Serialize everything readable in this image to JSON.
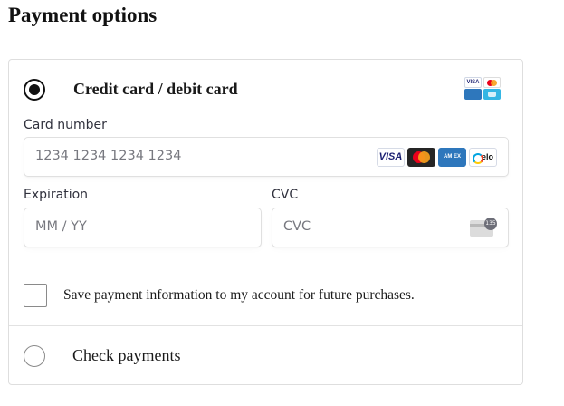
{
  "page": {
    "title": "Payment options"
  },
  "payment_methods": [
    {
      "label": "Credit card / debit card",
      "selected": true,
      "icons": [
        "visa-mini-icon",
        "mastercard-mini-icon",
        "amex-mini-icon",
        "elo-mini-icon"
      ]
    },
    {
      "label": "Check payments",
      "selected": false
    }
  ],
  "card_form": {
    "card_number": {
      "label": "Card number",
      "placeholder": "1234 1234 1234 1234",
      "value": "",
      "brands": [
        {
          "name": "visa-icon",
          "text": "VISA"
        },
        {
          "name": "mastercard-icon",
          "text": ""
        },
        {
          "name": "amex-icon",
          "text": "AM EX"
        },
        {
          "name": "elo-icon",
          "text": "elo"
        }
      ]
    },
    "expiration": {
      "label": "Expiration",
      "placeholder": "MM / YY",
      "value": ""
    },
    "cvc": {
      "label": "CVC",
      "placeholder": "CVC",
      "value": "",
      "icon": "cvc-card-icon",
      "icon_badge": "135"
    }
  },
  "save_option": {
    "label": "Save payment information to my account for future purchases.",
    "checked": false
  }
}
